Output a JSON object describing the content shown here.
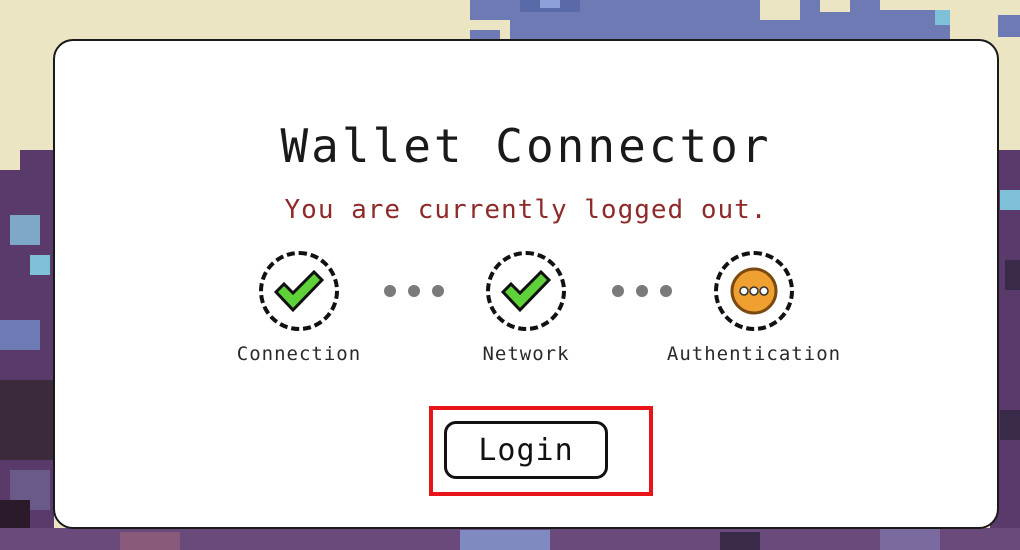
{
  "connector": {
    "title": "Wallet Connector",
    "status_message": "You are currently logged out.",
    "steps": [
      {
        "label": "Connection",
        "state": "complete",
        "icon": "check-icon"
      },
      {
        "label": "Network",
        "state": "complete",
        "icon": "check-icon"
      },
      {
        "label": "Authentication",
        "state": "pending",
        "icon": "ellipsis-icon"
      }
    ],
    "login_label": "Login"
  },
  "colors": {
    "status_text": "#8e2a2a",
    "check_fill": "#5fd23a",
    "pending_fill": "#f0a030",
    "highlight": "#e8141a"
  }
}
